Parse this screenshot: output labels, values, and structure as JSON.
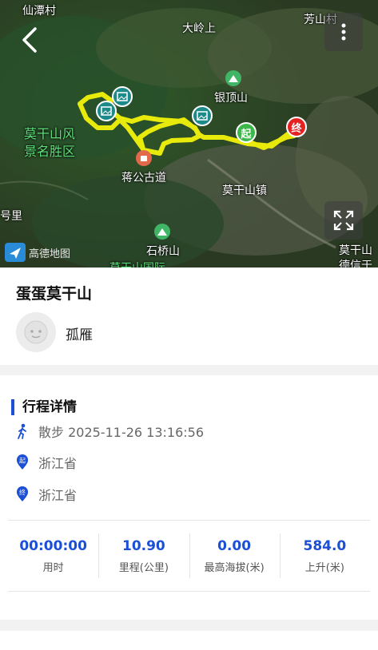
{
  "map": {
    "labels": {
      "xiantan": "仙潭村",
      "daling": "大岭上",
      "fangshan": "芳山村",
      "yindingshan": "银顶山",
      "scenic1": "莫干山风",
      "scenic2": "景名胜区",
      "jianggong": "蒋公古道",
      "zhen": "莫干山镇",
      "li": "号里",
      "shiqiao": "石桥山",
      "guoji": "莫干山国际",
      "moganshan_r": "莫干山",
      "deqing": "德信于"
    },
    "start_marker": "起",
    "end_marker": "终",
    "provider": "高德地图",
    "accent_route": "#f2f20a"
  },
  "trip": {
    "title": "蛋蛋莫干山",
    "user": "孤雁"
  },
  "details": {
    "section_title": "行程详情",
    "activity": "散步 2025-11-26 13:16:56",
    "start_marker": "起",
    "start_province": "浙江省",
    "end_marker": "终",
    "end_province": "浙江省",
    "stats": [
      {
        "value": "00:00:00",
        "label": "用时"
      },
      {
        "value": "10.90",
        "label": "里程(公里)"
      },
      {
        "value": "0.00",
        "label": "最高海拔(米)"
      },
      {
        "value": "584.0",
        "label": "上升(米)"
      }
    ]
  }
}
